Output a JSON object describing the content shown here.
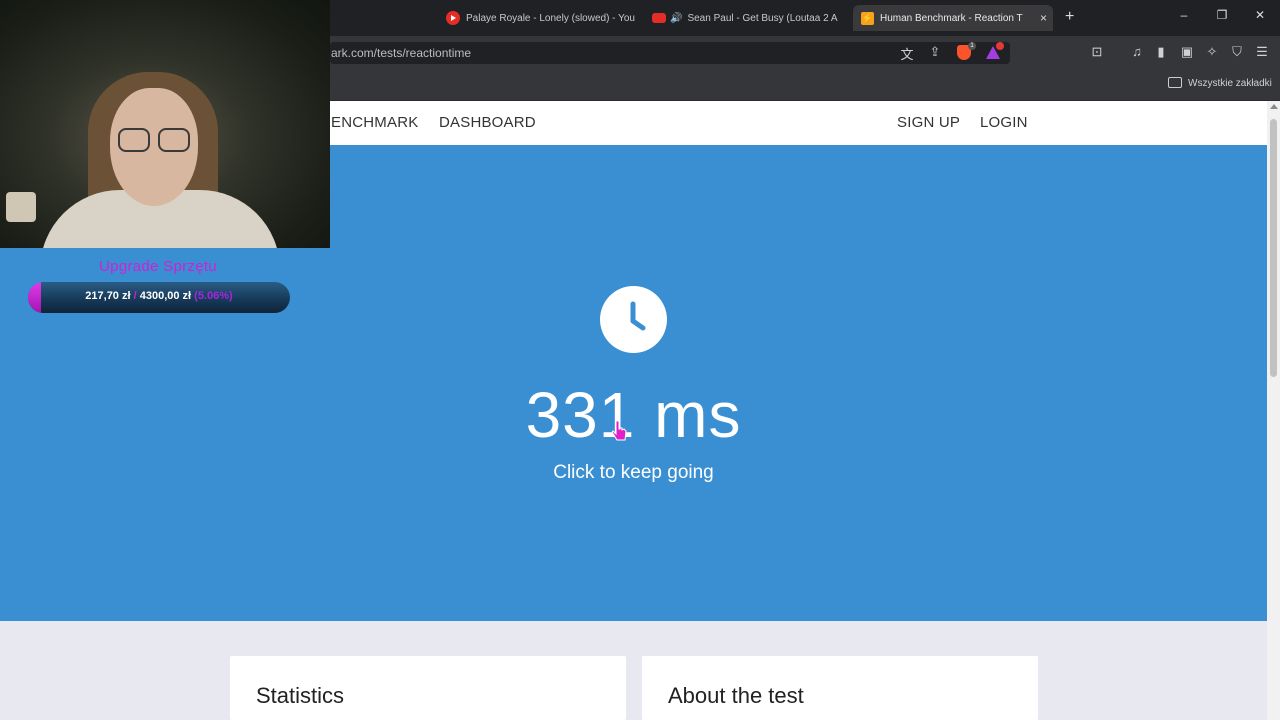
{
  "browser": {
    "tabs": [
      {
        "title": "Palaye Royale - Lonely (slowed) - You",
        "icon": "youtube-icon"
      },
      {
        "title": "Sean Paul - Get Busy (Loutaa 2 A",
        "icon": "youtube-icon",
        "audio": "speaker-icon"
      },
      {
        "title": "Human Benchmark - Reaction T",
        "icon": "humanbenchmark-icon",
        "close": "×"
      }
    ],
    "new_tab": "+",
    "window_controls": {
      "minimize": "–",
      "maximize": "❐",
      "close": "✕"
    },
    "url": "ark.com/tests/reactiontime",
    "brave_badge": "1",
    "bookmarks_label": "Wszystkie zakładki"
  },
  "site": {
    "nav": {
      "brand": "ENCHMARK",
      "dashboard": "DASHBOARD",
      "signup": "SIGN UP",
      "login": "LOGIN"
    },
    "result": "331 ms",
    "subtext": "Click to keep going",
    "cards": {
      "statistics": "Statistics",
      "about": "About the test"
    },
    "colors": {
      "hero": "#3a8fd2",
      "below": "#e8e8f0"
    }
  },
  "overlay": {
    "goal_title": "Upgrade Sprzętu",
    "goal_current": "217,70 zł",
    "goal_separator": "/",
    "goal_target": "4300,00 zł",
    "goal_percent": "(5.06%)",
    "goal_progress": 0.0506,
    "colors": {
      "accent": "#d21fd6",
      "bar": "#173a5a"
    }
  }
}
